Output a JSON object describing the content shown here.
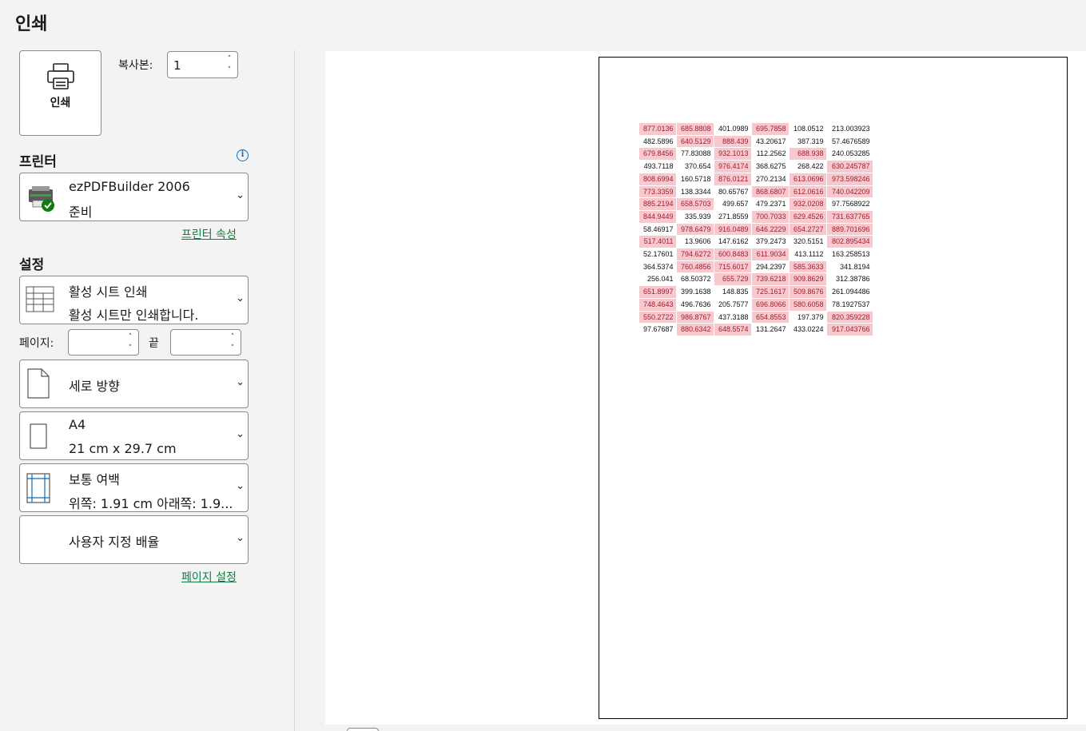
{
  "title": "인쇄",
  "print_button": {
    "label": "인쇄"
  },
  "copies": {
    "label": "복사본:",
    "value": "1"
  },
  "printer": {
    "section": "프린터",
    "name": "ezPDFBuilder 2006",
    "status": "준비",
    "properties_link": "프린터 속성"
  },
  "settings": {
    "section": "설정",
    "print_what": {
      "title": "활성 시트 인쇄",
      "subtitle": "활성 시트만 인쇄합니다."
    },
    "pages_label": "페이지:",
    "pages_from": "",
    "to_label": "끝",
    "pages_to": "",
    "orientation": "세로 방향",
    "paper": {
      "title": "A4",
      "subtitle": "21 cm x 29.7 cm"
    },
    "margins": {
      "title": "보통 여백",
      "subtitle": "위쪽: 1.91 cm 아래쪽: 1.9..."
    },
    "scaling": "사용자 지정 배율",
    "page_setup_link": "페이지 설정"
  },
  "preview": {
    "rows": [
      [
        "877.0136",
        "685.8808",
        "401.0989",
        "695.7858",
        "108.0512",
        "213.003923"
      ],
      [
        "482.5896",
        "640.5129",
        "888.439",
        "43.20617",
        "387.319",
        "57.4676589"
      ],
      [
        "679.8456",
        "77.83088",
        "932.1013",
        "112.2562",
        "688.938",
        "240.053285"
      ],
      [
        "493.7118",
        "370.654",
        "976.4174",
        "368.6275",
        "268.422",
        "630.245787"
      ],
      [
        "808.6994",
        "160.5718",
        "876.0121",
        "270.2134",
        "613.0696",
        "973.598246"
      ],
      [
        "773.3359",
        "138.3344",
        "80.65767",
        "868.6807",
        "612.0616",
        "740.042209"
      ],
      [
        "885.2194",
        "658.5703",
        "499.657",
        "479.2371",
        "932.0208",
        "97.7568922"
      ],
      [
        "844.9449",
        "335.939",
        "271.8559",
        "700.7033",
        "629.4526",
        "731.637765"
      ],
      [
        "58.46917",
        "978.6479",
        "916.0489",
        "646.2229",
        "654.2727",
        "889.701696"
      ],
      [
        "517.4011",
        "13.9606",
        "147.6162",
        "379.2473",
        "320.5151",
        "802.895434"
      ],
      [
        "52.17601",
        "794.6272",
        "600.8483",
        "611.9034",
        "413.1112",
        "163.258513"
      ],
      [
        "364.5374",
        "760.4856",
        "715.6017",
        "294.2397",
        "585.3633",
        "341.8194"
      ],
      [
        "256.041",
        "68.50372",
        "655.729",
        "739.6218",
        "909.8629",
        "312.38786"
      ],
      [
        "651.8997",
        "399.1638",
        "148.835",
        "725.1617",
        "509.8676",
        "261.094486"
      ],
      [
        "748.4643",
        "496.7636",
        "205.7577",
        "696.8066",
        "580.6058",
        "78.1927537"
      ],
      [
        "550.2722",
        "986.8767",
        "437.3188",
        "654.8553",
        "197.379",
        "820.359228"
      ],
      [
        "97.67687",
        "880.6342",
        "648.5574",
        "131.2647",
        "433.0224",
        "917.043766"
      ]
    ],
    "highlight_threshold": 500,
    "highlight_color": "#f8c8cf",
    "highlight_text_color": "#a0202c"
  }
}
